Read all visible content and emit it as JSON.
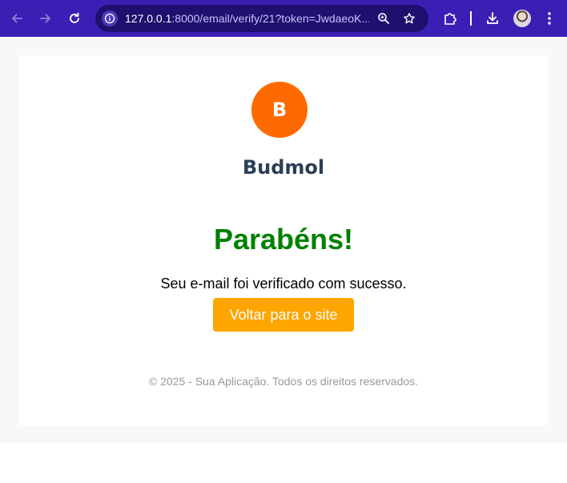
{
  "browser": {
    "url_host": "127.0.0.1",
    "url_rest": ":8000/email/verify/21?token=JwdaeoK..."
  },
  "icons": {
    "back": "arrow-left-icon",
    "forward": "arrow-right-icon",
    "reload": "reload-icon",
    "site_info": "info-icon",
    "zoom": "zoom-icon",
    "bookmark": "star-icon",
    "extensions": "puzzle-icon",
    "download": "download-icon",
    "menu": "kebab-menu-icon"
  },
  "colors": {
    "toolbar": "#3b1fb5",
    "logo": "#ff6a00",
    "headline": "#008000",
    "button": "#ffa500"
  },
  "email": {
    "logo_letter": "B",
    "brand_name": "Budmol",
    "headline": "Parabéns!",
    "message": "Seu e-mail foi verificado com sucesso.",
    "button_label": "Voltar para o site",
    "footer": "© 2025 - Sua Aplicação. Todos os direitos reservados."
  }
}
